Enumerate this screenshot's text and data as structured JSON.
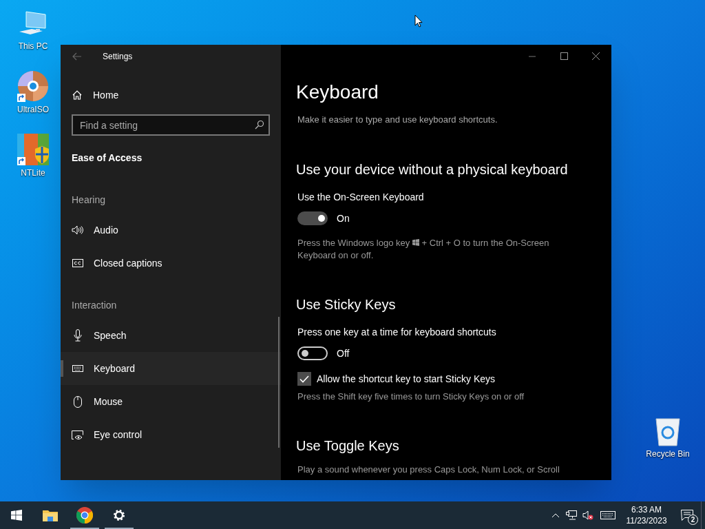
{
  "desktop_icons": [
    {
      "label": "This PC",
      "kind": "pc"
    },
    {
      "label": "UltraISO",
      "kind": "disc",
      "shortcut": true
    },
    {
      "label": "NTLite",
      "kind": "ntlite",
      "shortcut": true
    }
  ],
  "desktop_icons_right": [
    {
      "label": "Recycle Bin",
      "kind": "bin"
    }
  ],
  "window": {
    "title": "Settings"
  },
  "sidebar": {
    "home": "Home",
    "search": {
      "placeholder": "Find a setting"
    },
    "category": "Ease of Access",
    "groups": [
      {
        "heading": "Hearing",
        "items": [
          {
            "label": "Audio",
            "kind": "speaker",
            "selected": false
          },
          {
            "label": "Closed captions",
            "kind": "cc",
            "selected": false
          }
        ]
      },
      {
        "heading": "Interaction",
        "items": [
          {
            "label": "Speech",
            "kind": "mic",
            "selected": false
          },
          {
            "label": "Keyboard",
            "kind": "keyboard",
            "selected": true
          },
          {
            "label": "Mouse",
            "kind": "mouse",
            "selected": false
          },
          {
            "label": "Eye control",
            "kind": "eye",
            "selected": false
          }
        ]
      }
    ]
  },
  "content": {
    "title": "Keyboard",
    "description": "Make it easier to type and use keyboard shortcuts.",
    "sections": [
      {
        "heading": "Use your device without a physical keyboard",
        "items": [
          {
            "kind": "toggle",
            "label": "Use the On-Screen Keyboard",
            "on": true,
            "state_text": "On"
          },
          {
            "kind": "note",
            "text": "Press the Windows logo key",
            "logo": true,
            "text_after": "+ Ctrl + O to turn the On-Screen Keyboard on or off."
          }
        ]
      },
      {
        "heading": "Use Sticky Keys",
        "items": [
          {
            "kind": "toggle",
            "label": "Press one key at a time for keyboard shortcuts",
            "on": false,
            "state_text": "Off"
          },
          {
            "kind": "checkbox",
            "label": "Allow the shortcut key to start Sticky Keys",
            "checked": true
          },
          {
            "kind": "note",
            "text": "Press the Shift key five times to turn Sticky Keys on or off"
          }
        ]
      },
      {
        "heading": "Use Toggle Keys",
        "items": [
          {
            "kind": "note",
            "text": "Play a sound whenever you press Caps Lock, Num Lock, or Scroll"
          }
        ]
      }
    ]
  },
  "taskbar": {
    "apps": [
      {
        "kind": "folder",
        "running": false
      },
      {
        "kind": "chrome",
        "running": true
      },
      {
        "kind": "gear",
        "running": true
      }
    ],
    "tray": {
      "time": "6:33 AM",
      "date": "11/23/2023",
      "notifications": "2"
    }
  }
}
